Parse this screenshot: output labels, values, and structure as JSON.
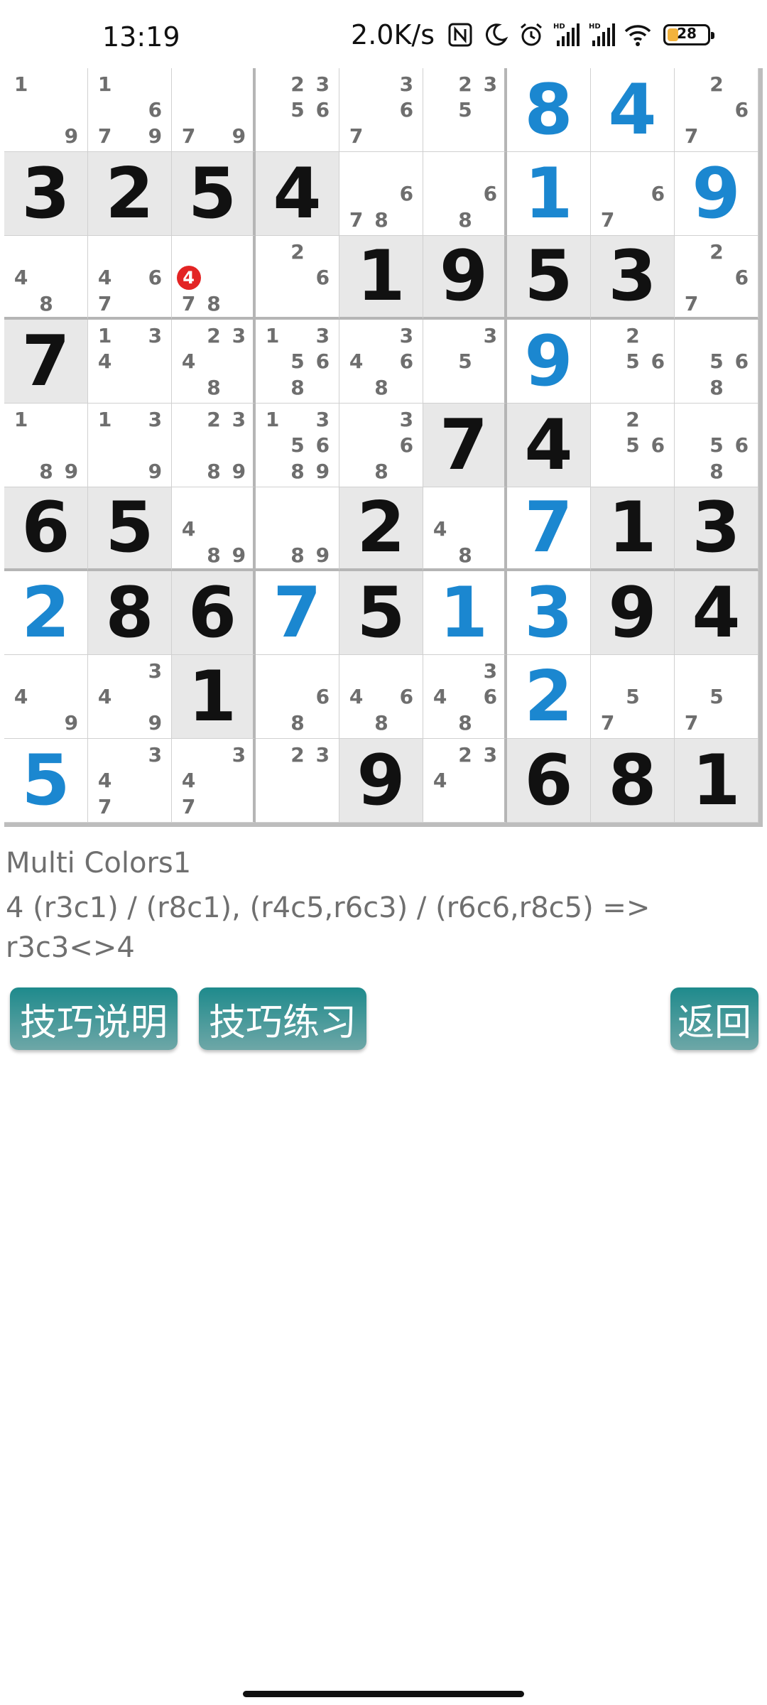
{
  "status_bar": {
    "time": "13:19",
    "network_speed": "2.0K/s",
    "icons": [
      "nfc-icon",
      "moon-icon",
      "alarm-icon",
      "signal-hd-icon",
      "signal-hd-icon",
      "wifi-icon"
    ],
    "battery_level": 28,
    "battery_text": "28"
  },
  "board": {
    "cells": [
      [
        {
          "c": [
            1,
            9
          ]
        },
        {
          "c": [
            1,
            6,
            7,
            9
          ]
        },
        {
          "c": [
            7,
            9
          ]
        },
        {
          "c": [
            2,
            3,
            5,
            6
          ]
        },
        {
          "c": [
            3,
            6,
            7
          ]
        },
        {
          "c": [
            2,
            3,
            5
          ]
        },
        {
          "v": 8,
          "t": "s"
        },
        {
          "v": 4,
          "t": "s"
        },
        {
          "c": [
            2,
            6,
            7
          ]
        }
      ],
      [
        {
          "v": 3,
          "t": "g"
        },
        {
          "v": 2,
          "t": "g"
        },
        {
          "v": 5,
          "t": "g"
        },
        {
          "v": 4,
          "t": "g"
        },
        {
          "c": [
            6,
            7,
            8
          ]
        },
        {
          "c": [
            6,
            8
          ]
        },
        {
          "v": 1,
          "t": "s"
        },
        {
          "c": [
            6,
            7
          ]
        },
        {
          "v": 9,
          "t": "s"
        }
      ],
      [
        {
          "c": [
            4,
            8
          ]
        },
        {
          "c": [
            4,
            6,
            7
          ]
        },
        {
          "c": [
            4,
            7,
            8
          ],
          "hl": 4
        },
        {
          "c": [
            2,
            6
          ]
        },
        {
          "v": 1,
          "t": "g"
        },
        {
          "v": 9,
          "t": "g"
        },
        {
          "v": 5,
          "t": "g"
        },
        {
          "v": 3,
          "t": "g"
        },
        {
          "c": [
            2,
            6,
            7
          ]
        }
      ],
      [
        {
          "v": 7,
          "t": "g"
        },
        {
          "c": [
            1,
            3,
            4
          ]
        },
        {
          "c": [
            2,
            3,
            4,
            8
          ]
        },
        {
          "c": [
            1,
            3,
            5,
            6,
            8
          ]
        },
        {
          "c": [
            3,
            4,
            6,
            8
          ]
        },
        {
          "c": [
            3,
            5
          ]
        },
        {
          "v": 9,
          "t": "s"
        },
        {
          "c": [
            2,
            5,
            6
          ]
        },
        {
          "c": [
            5,
            6,
            8
          ]
        }
      ],
      [
        {
          "c": [
            1,
            8,
            9
          ]
        },
        {
          "c": [
            1,
            3,
            9
          ]
        },
        {
          "c": [
            2,
            3,
            8,
            9
          ]
        },
        {
          "c": [
            1,
            3,
            5,
            6,
            8,
            9
          ]
        },
        {
          "c": [
            3,
            6,
            8
          ]
        },
        {
          "v": 7,
          "t": "g"
        },
        {
          "v": 4,
          "t": "g"
        },
        {
          "c": [
            2,
            5,
            6
          ]
        },
        {
          "c": [
            5,
            6,
            8
          ]
        }
      ],
      [
        {
          "v": 6,
          "t": "g"
        },
        {
          "v": 5,
          "t": "g"
        },
        {
          "c": [
            4,
            8,
            9
          ]
        },
        {
          "c": [
            8,
            9
          ]
        },
        {
          "v": 2,
          "t": "g"
        },
        {
          "c": [
            4,
            8
          ]
        },
        {
          "v": 7,
          "t": "s"
        },
        {
          "v": 1,
          "t": "g"
        },
        {
          "v": 3,
          "t": "g"
        }
      ],
      [
        {
          "v": 2,
          "t": "s"
        },
        {
          "v": 8,
          "t": "g"
        },
        {
          "v": 6,
          "t": "g"
        },
        {
          "v": 7,
          "t": "s"
        },
        {
          "v": 5,
          "t": "g"
        },
        {
          "v": 1,
          "t": "s"
        },
        {
          "v": 3,
          "t": "s"
        },
        {
          "v": 9,
          "t": "g"
        },
        {
          "v": 4,
          "t": "g"
        }
      ],
      [
        {
          "c": [
            4,
            9
          ]
        },
        {
          "c": [
            3,
            4,
            9
          ]
        },
        {
          "v": 1,
          "t": "g"
        },
        {
          "c": [
            6,
            8
          ]
        },
        {
          "c": [
            4,
            6,
            8
          ]
        },
        {
          "c": [
            3,
            4,
            6,
            8
          ]
        },
        {
          "v": 2,
          "t": "s"
        },
        {
          "c": [
            5,
            7
          ]
        },
        {
          "c": [
            5,
            7
          ]
        }
      ],
      [
        {
          "v": 5,
          "t": "s"
        },
        {
          "c": [
            3,
            4,
            7
          ]
        },
        {
          "c": [
            3,
            4,
            7
          ]
        },
        {
          "c": [
            2,
            3
          ]
        },
        {
          "v": 9,
          "t": "g"
        },
        {
          "c": [
            2,
            3,
            4
          ]
        },
        {
          "v": 6,
          "t": "g"
        },
        {
          "v": 8,
          "t": "g"
        },
        {
          "v": 1,
          "t": "g"
        }
      ]
    ]
  },
  "hint": {
    "title": "Multi Colors1",
    "body": "4 (r3c1) / (r8c1), (r4c5,r6c3) / (r6c6,r8c5) => r3c3<>4"
  },
  "buttons": {
    "explain": "技巧说明",
    "practice": "技巧练习",
    "back": "返回"
  },
  "colors": {
    "solved_digit": "#1b87d0",
    "given_digit": "#111111",
    "candidate": "#6e6e6e",
    "highlight": "#e32424",
    "button": "#1e8a8c"
  }
}
